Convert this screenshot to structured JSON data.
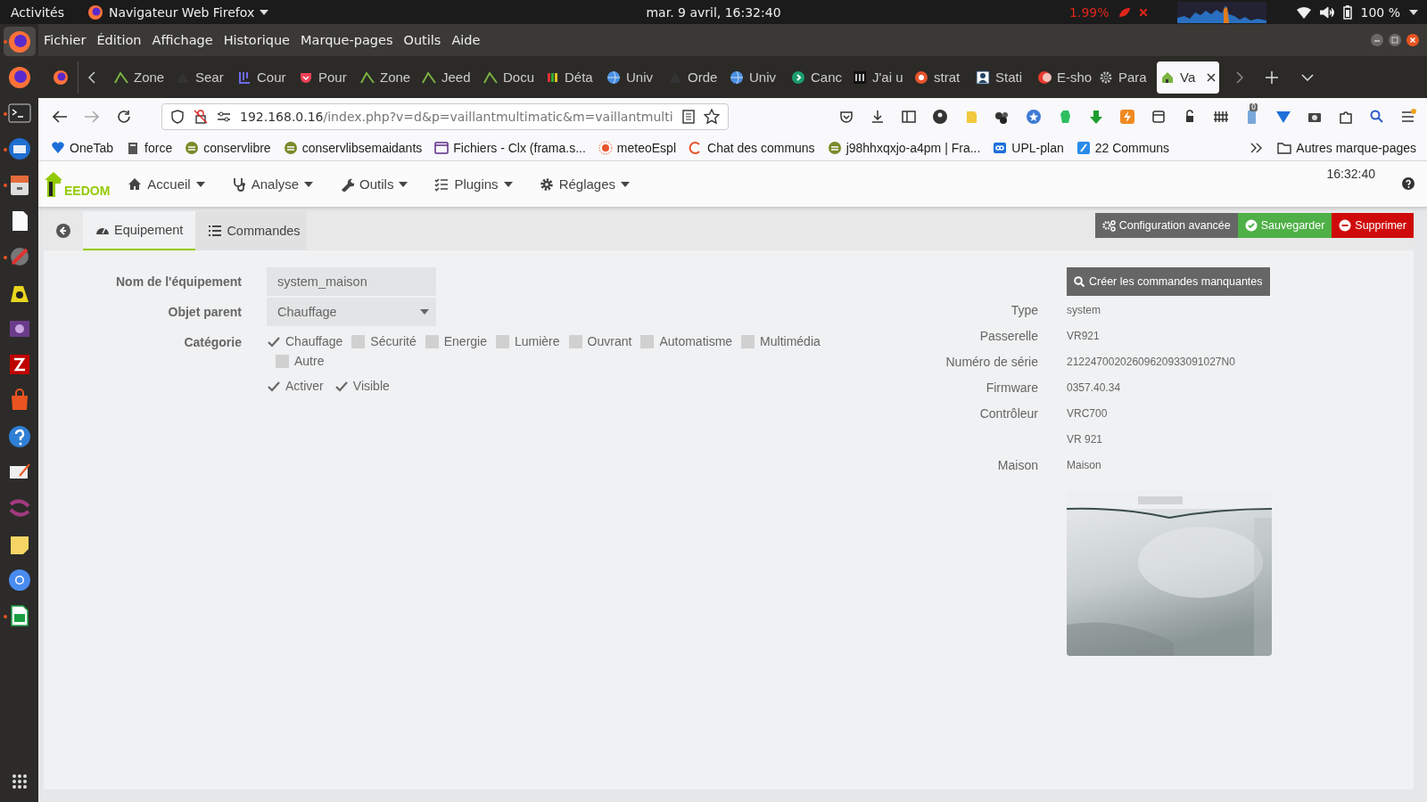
{
  "top_bar": {
    "activities": "Activités",
    "app": "Navigateur Web Firefox",
    "clock": "mar.  9 avril, 16:32:40",
    "cpu": "1.99%",
    "battery": "100 %"
  },
  "dock": [
    {
      "running": true,
      "selected": true
    },
    {
      "running": false,
      "selected": false
    },
    {
      "running": true,
      "selected": false
    },
    {
      "running": true,
      "selected": false
    },
    {
      "running": true,
      "selected": false
    },
    {
      "running": false,
      "selected": false
    },
    {
      "running": true,
      "selected": false
    },
    {
      "running": false,
      "selected": false
    },
    {
      "running": false,
      "selected": false
    },
    {
      "running": false,
      "selected": false
    },
    {
      "running": false,
      "selected": false
    },
    {
      "running": false,
      "selected": false
    },
    {
      "running": false,
      "selected": false
    },
    {
      "running": false,
      "selected": false
    },
    {
      "running": false,
      "selected": false
    },
    {
      "running": false,
      "selected": false
    },
    {
      "running": true,
      "selected": false
    }
  ],
  "menu_bar": [
    "Fichier",
    "Édition",
    "Affichage",
    "Historique",
    "Marque-pages",
    "Outils",
    "Aide"
  ],
  "tabs": [
    {
      "label": "Zone",
      "selected": false
    },
    {
      "label": "Sear",
      "selected": false
    },
    {
      "label": "Cour",
      "selected": false
    },
    {
      "label": "Pour",
      "selected": false
    },
    {
      "label": "Zone",
      "selected": false
    },
    {
      "label": "Jeed",
      "selected": false
    },
    {
      "label": "Docu",
      "selected": false
    },
    {
      "label": "Déta",
      "selected": false
    },
    {
      "label": "Univ",
      "selected": false
    },
    {
      "label": "Orde",
      "selected": false
    },
    {
      "label": "Univ",
      "selected": false
    },
    {
      "label": "Canc",
      "selected": false
    },
    {
      "label": "J'ai u",
      "selected": false
    },
    {
      "label": "strat",
      "selected": false
    },
    {
      "label": "Stati",
      "selected": false
    },
    {
      "label": "E-sho",
      "selected": false
    },
    {
      "label": "Para",
      "selected": false
    },
    {
      "label": "Va",
      "selected": true
    }
  ],
  "address_bar": {
    "host": "192.168.0.16",
    "path": "/index.php?v=d&p=vaillantmultimatic&m=vaillantmulti"
  },
  "extension_badge": "0",
  "bookmarks": [
    "OneTab",
    "force",
    "conservlibre",
    "conservlibsemaidants",
    "Fichiers - Clx (frama.s...",
    "meteoEspl",
    "Chat des communs",
    "j98hhxqxjo-a4pm | Fra...",
    "UPL-plan",
    "22 Communs"
  ],
  "other_bookmarks": "Autres marque-pages",
  "jeedom": {
    "logo": "EEDOM",
    "menu": [
      "Accueil",
      "Analyse",
      "Outils",
      "Plugins",
      "Réglages"
    ],
    "time": "16:32:40"
  },
  "page_tabs": [
    {
      "label": "Equipement",
      "selected": true
    },
    {
      "label": "Commandes",
      "selected": false
    }
  ],
  "actions": [
    {
      "label": "Configuration avancée",
      "kind": "config"
    },
    {
      "label": "Sauvegarder",
      "kind": "save"
    },
    {
      "label": "Supprimer",
      "kind": "delete"
    }
  ],
  "form": {
    "name": {
      "label": "Nom de l'équipement",
      "value": "system_maison"
    },
    "parent": {
      "label": "Objet parent",
      "value": "Chauffage"
    },
    "category": {
      "label": "Catégorie",
      "options": [
        {
          "label": "Chauffage",
          "checked": true
        },
        {
          "label": "Sécurité",
          "checked": false
        },
        {
          "label": "Energie",
          "checked": false
        },
        {
          "label": "Lumière",
          "checked": false
        },
        {
          "label": "Ouvrant",
          "checked": false
        },
        {
          "label": "Automatisme",
          "checked": false
        },
        {
          "label": "Multimédia",
          "checked": false
        },
        {
          "label": "Autre",
          "checked": false
        }
      ]
    },
    "flags": [
      {
        "label": "Activer",
        "checked": true
      },
      {
        "label": "Visible",
        "checked": true
      }
    ]
  },
  "create_button": "Créer les commandes manquantes",
  "info": [
    {
      "label": "Type",
      "value": "system"
    },
    {
      "label": "Passerelle",
      "value": "VR921"
    },
    {
      "label": "Numéro de série",
      "value": "21224700202609620933091027N0"
    },
    {
      "label": "Firmware",
      "value": "0357.40.34"
    },
    {
      "label": "Contrôleur",
      "value": "VRC700"
    },
    {
      "value": "VR 921"
    },
    {
      "label": "Maison",
      "value": "Maison"
    }
  ],
  "device_image": {
    "kind": "picture"
  }
}
